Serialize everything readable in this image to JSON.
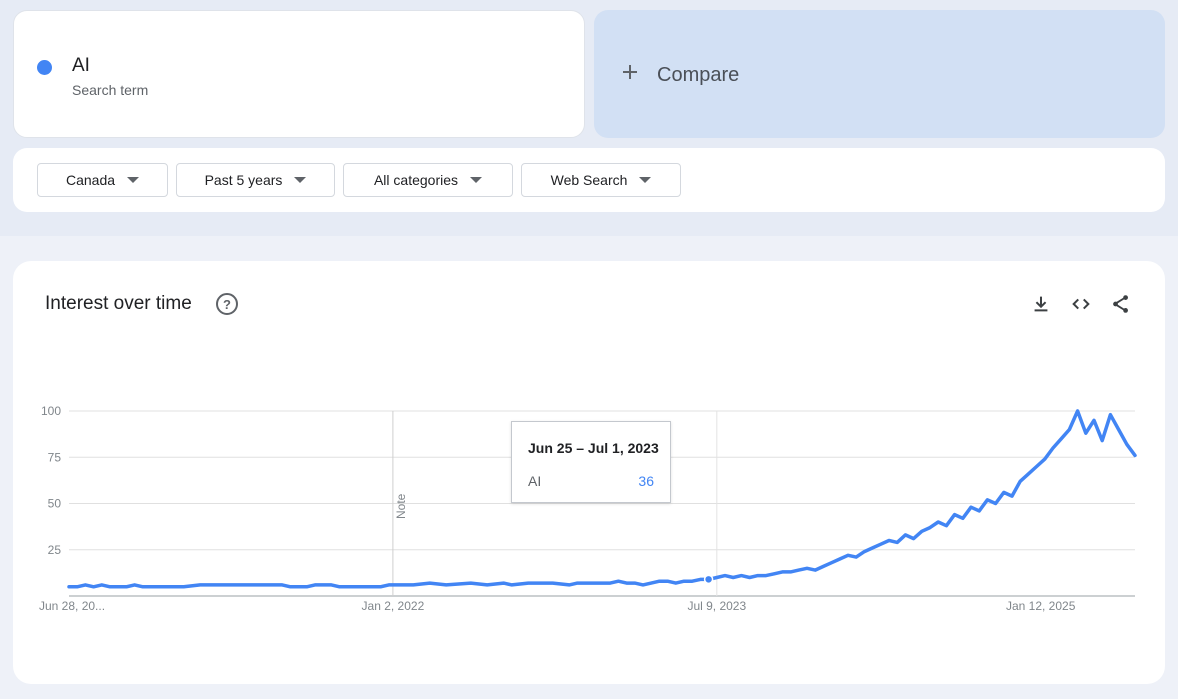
{
  "search_term": {
    "name": "AI",
    "subtitle": "Search term",
    "color": "#4285f4"
  },
  "compare": {
    "label": "Compare",
    "icon": "plus-icon"
  },
  "filters": [
    {
      "label": "Canada"
    },
    {
      "label": "Past 5 years"
    },
    {
      "label": "All categories"
    },
    {
      "label": "Web Search"
    }
  ],
  "chart_panel": {
    "title": "Interest over time",
    "icons": [
      "help-icon",
      "download-icon",
      "embed-code-icon",
      "share-icon"
    ]
  },
  "tooltip": {
    "date": "Jun 25 – Jul 1, 2023",
    "term": "AI",
    "value": "36"
  },
  "chart_data": {
    "type": "line",
    "title": "Interest over time",
    "xlabel": "",
    "ylabel": "",
    "x_tick_labels": [
      "Jun 28, 20...",
      "Jan 2, 2022",
      "Jul 9, 2023",
      "Jan 12, 2025"
    ],
    "y_ticks": [
      25,
      50,
      75,
      100
    ],
    "ylim": [
      0,
      100
    ],
    "xlim": [
      "2020-06-28",
      "2025-06-22"
    ],
    "grid": true,
    "annotation": "Note",
    "series": [
      {
        "name": "AI",
        "color": "#4285f4",
        "points": [
          [
            "2020-06-28",
            5
          ],
          [
            "2020-07-12",
            5
          ],
          [
            "2020-07-26",
            6
          ],
          [
            "2020-08-09",
            5
          ],
          [
            "2020-08-23",
            6
          ],
          [
            "2020-09-06",
            5
          ],
          [
            "2020-10-04",
            5
          ],
          [
            "2020-10-18",
            6
          ],
          [
            "2020-11-01",
            5
          ],
          [
            "2020-12-13",
            5
          ],
          [
            "2021-01-10",
            5
          ],
          [
            "2021-02-07",
            6
          ],
          [
            "2021-04-04",
            6
          ],
          [
            "2021-06-27",
            6
          ],
          [
            "2021-07-11",
            5
          ],
          [
            "2021-08-08",
            5
          ],
          [
            "2021-08-22",
            6
          ],
          [
            "2021-09-19",
            6
          ],
          [
            "2021-10-03",
            5
          ],
          [
            "2021-12-12",
            5
          ],
          [
            "2021-12-26",
            6
          ],
          [
            "2022-02-06",
            6
          ],
          [
            "2022-03-06",
            7
          ],
          [
            "2022-04-03",
            6
          ],
          [
            "2022-05-15",
            7
          ],
          [
            "2022-06-12",
            6
          ],
          [
            "2022-07-10",
            7
          ],
          [
            "2022-07-24",
            6
          ],
          [
            "2022-08-21",
            7
          ],
          [
            "2022-10-02",
            7
          ],
          [
            "2022-10-30",
            6
          ],
          [
            "2022-11-13",
            7
          ],
          [
            "2022-12-11",
            7
          ],
          [
            "2023-01-08",
            7
          ],
          [
            "2023-01-22",
            8
          ],
          [
            "2023-02-05",
            7
          ],
          [
            "2023-02-19",
            7
          ],
          [
            "2023-03-05",
            6
          ],
          [
            "2023-03-19",
            7
          ],
          [
            "2023-04-02",
            8
          ],
          [
            "2023-04-16",
            8
          ],
          [
            "2023-04-30",
            7
          ],
          [
            "2023-05-14",
            8
          ],
          [
            "2023-05-28",
            8
          ],
          [
            "2023-06-11",
            9
          ],
          [
            "2023-06-25",
            9
          ],
          [
            "2023-07-09",
            10
          ],
          [
            "2023-07-23",
            11
          ],
          [
            "2023-08-06",
            10
          ],
          [
            "2023-08-20",
            11
          ],
          [
            "2023-09-03",
            10
          ],
          [
            "2023-09-17",
            11
          ],
          [
            "2023-10-01",
            11
          ],
          [
            "2023-10-15",
            12
          ],
          [
            "2023-10-29",
            13
          ],
          [
            "2023-11-12",
            13
          ],
          [
            "2023-11-26",
            14
          ],
          [
            "2023-12-10",
            15
          ],
          [
            "2023-12-24",
            14
          ],
          [
            "2024-01-07",
            16
          ],
          [
            "2024-01-21",
            18
          ],
          [
            "2024-02-04",
            20
          ],
          [
            "2024-02-18",
            22
          ],
          [
            "2024-03-03",
            21
          ],
          [
            "2024-03-17",
            24
          ],
          [
            "2024-03-31",
            26
          ],
          [
            "2024-04-14",
            28
          ],
          [
            "2024-04-28",
            30
          ],
          [
            "2024-05-12",
            29
          ],
          [
            "2024-05-26",
            33
          ],
          [
            "2024-06-09",
            31
          ],
          [
            "2024-06-23",
            35
          ],
          [
            "2024-07-07",
            37
          ],
          [
            "2024-07-21",
            40
          ],
          [
            "2024-08-04",
            38
          ],
          [
            "2024-08-18",
            44
          ],
          [
            "2024-09-01",
            42
          ],
          [
            "2024-09-15",
            48
          ],
          [
            "2024-09-29",
            46
          ],
          [
            "2024-10-13",
            52
          ],
          [
            "2024-10-27",
            50
          ],
          [
            "2024-11-10",
            56
          ],
          [
            "2024-11-24",
            54
          ],
          [
            "2024-12-08",
            62
          ],
          [
            "2024-12-22",
            66
          ],
          [
            "2025-01-05",
            70
          ],
          [
            "2025-01-19",
            74
          ],
          [
            "2025-02-02",
            80
          ],
          [
            "2025-02-16",
            85
          ],
          [
            "2025-03-02",
            90
          ],
          [
            "2025-03-16",
            100
          ],
          [
            "2025-03-30",
            88
          ],
          [
            "2025-04-13",
            95
          ],
          [
            "2025-04-27",
            84
          ],
          [
            "2025-05-11",
            98
          ],
          [
            "2025-05-25",
            90
          ],
          [
            "2025-06-08",
            82
          ],
          [
            "2025-06-22",
            76
          ]
        ]
      }
    ]
  }
}
